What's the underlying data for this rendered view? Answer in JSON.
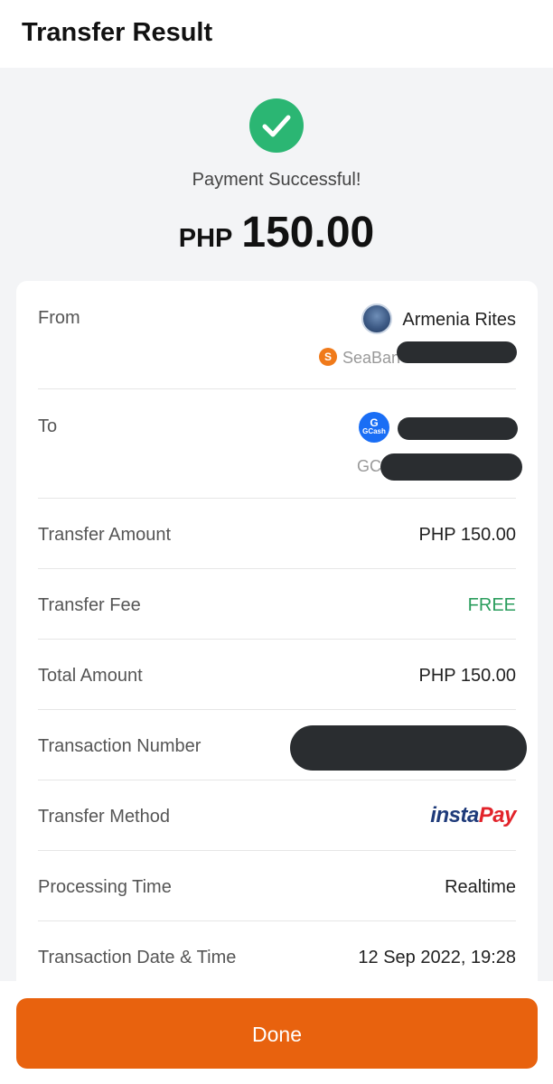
{
  "header": {
    "title": "Transfer Result"
  },
  "status": {
    "icon": "check-circle-icon",
    "message": "Payment Successful!",
    "currency": "PHP",
    "amount": "150.00",
    "color": "#2bb673"
  },
  "details": {
    "from": {
      "label": "From",
      "name": "Armenia Rites",
      "bank_visible": "SeaBan",
      "bank_icon": "seabank-icon"
    },
    "to": {
      "label": "To",
      "wallet_icon": "gcash-icon",
      "wallet_visible": "GC",
      "wallet_icon_label_top": "G",
      "wallet_icon_label_bottom": "GCash"
    },
    "transfer_amount": {
      "label": "Transfer Amount",
      "value": "PHP 150.00"
    },
    "transfer_fee": {
      "label": "Transfer Fee",
      "value": "FREE",
      "color": "#2a9d5c"
    },
    "total_amount": {
      "label": "Total Amount",
      "value": "PHP 150.00"
    },
    "transaction_number": {
      "label": "Transaction Number"
    },
    "transfer_method": {
      "label": "Transfer Method",
      "logo_part1": "insta",
      "logo_part2": "Pay"
    },
    "processing_time": {
      "label": "Processing Time",
      "value": "Realtime"
    },
    "date_time": {
      "label": "Transaction Date & Time",
      "value": "12 Sep 2022, 19:28"
    }
  },
  "footer": {
    "done_label": "Done",
    "accent": "#e8620e"
  }
}
